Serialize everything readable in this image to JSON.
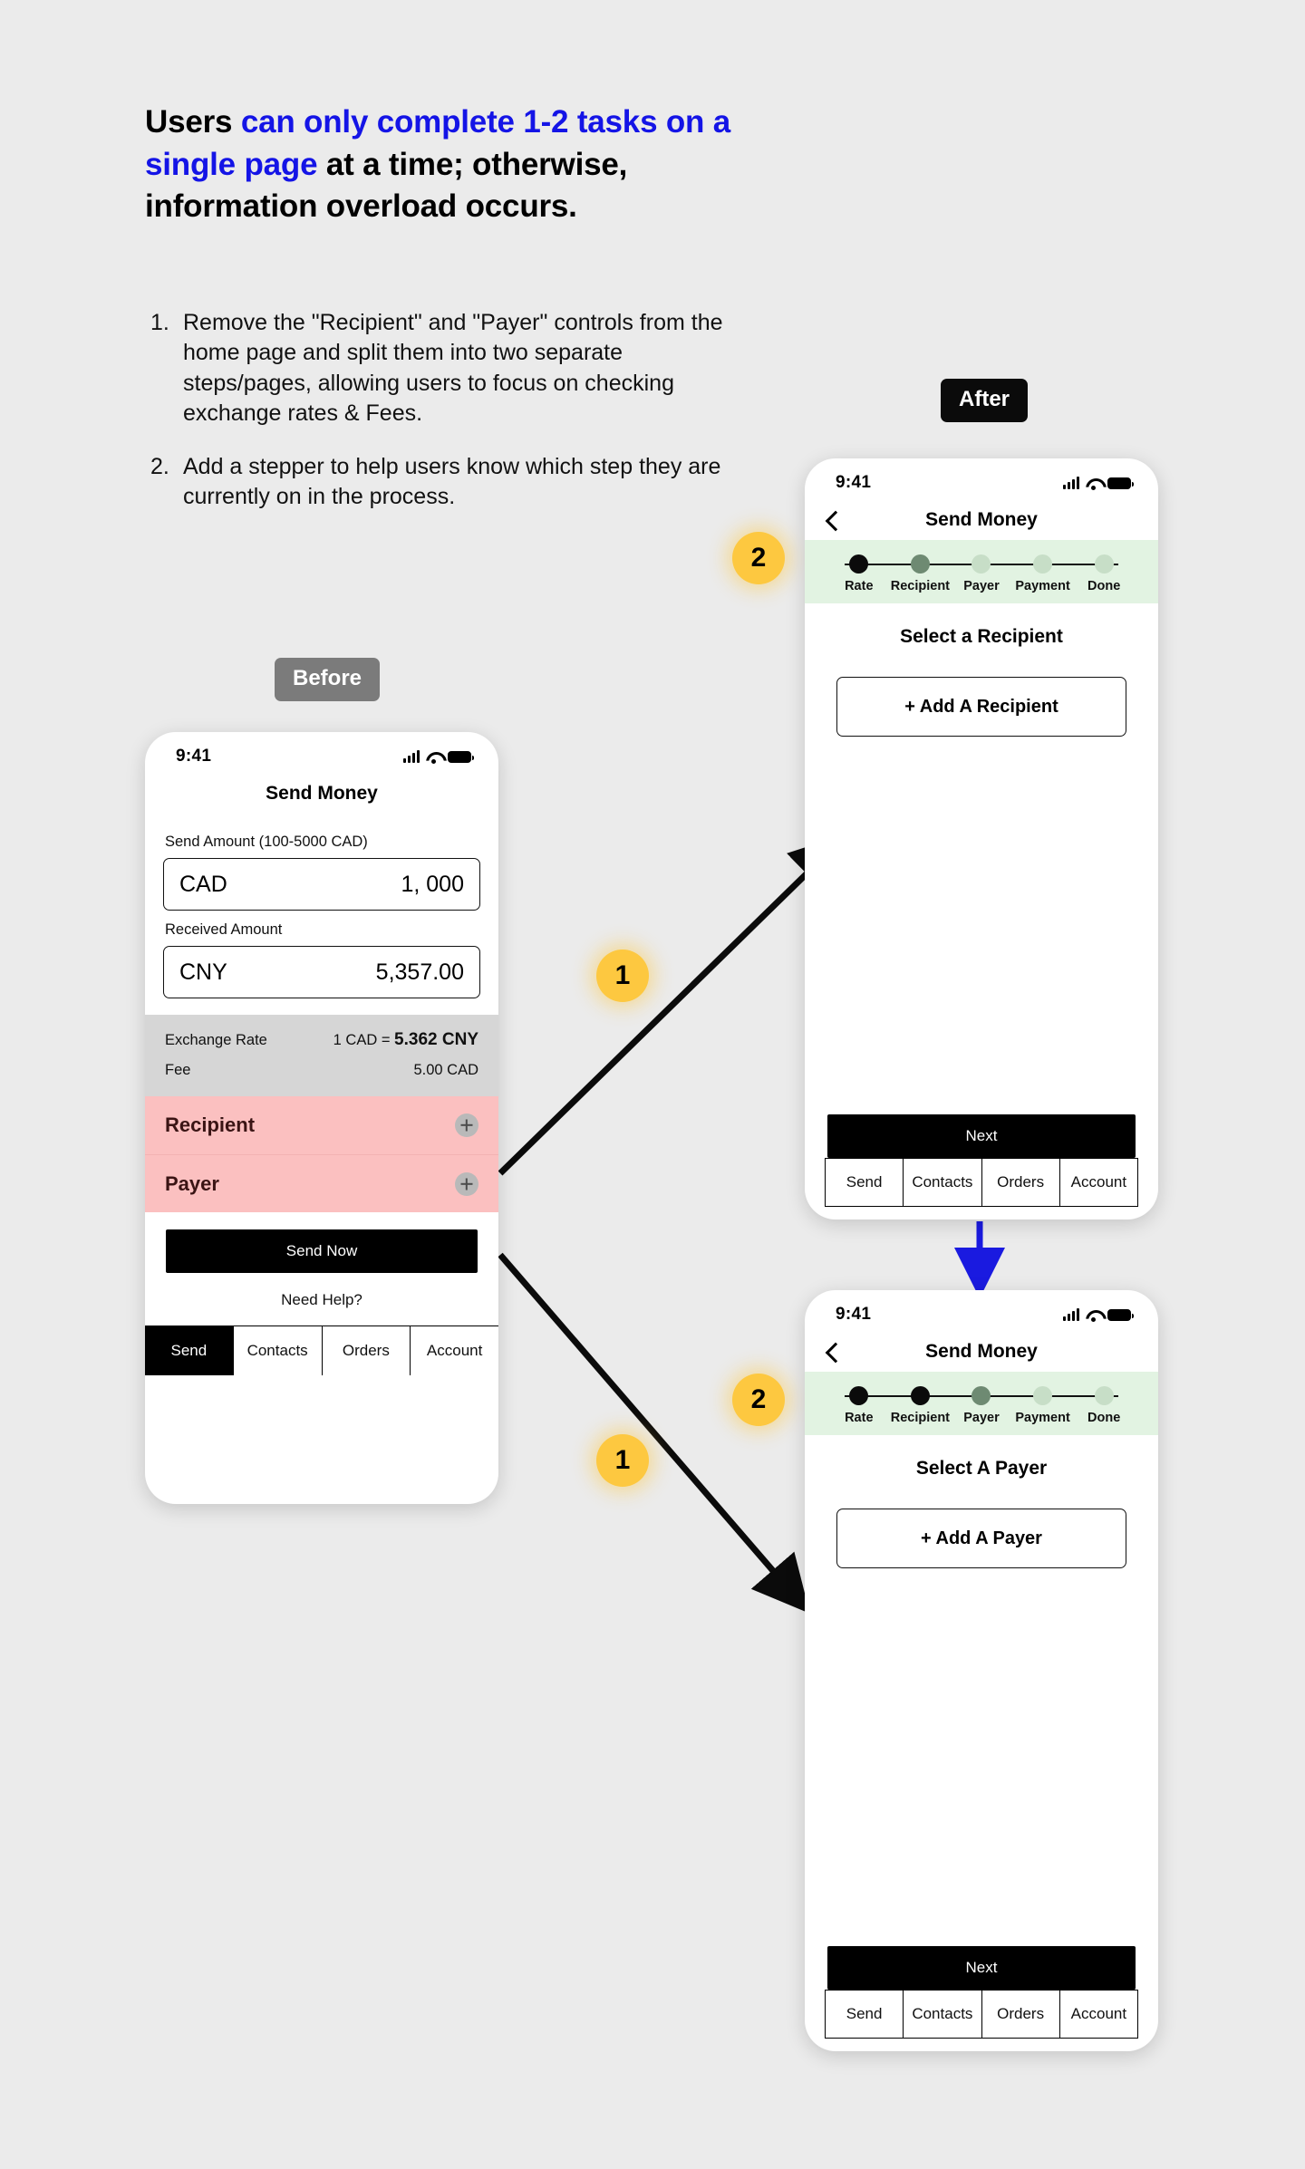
{
  "headline": {
    "lead": "Users ",
    "highlight": "can only complete 1-2 tasks on a single page",
    "tail": " at a time; otherwise, information overload occurs.",
    "highlight_color": "#1414e6"
  },
  "notes": [
    {
      "num": "1.",
      "text": "Remove the \"Recipient\" and \"Payer\" controls from the home page and split them into two separate steps/pages, allowing users to focus on checking exchange rates & Fees."
    },
    {
      "num": "2.",
      "text": "Add a stepper to help users know which step they are currently on in the process."
    }
  ],
  "pills": {
    "before": "Before",
    "after": "After"
  },
  "badges": {
    "one_a": "1",
    "one_b": "1",
    "two_a": "2",
    "two_b": "2",
    "color": "#fdc840"
  },
  "before_phone": {
    "status": {
      "time": "9:41",
      "signal": "signal-icon",
      "wifi": "wifi-icon",
      "battery": "battery-icon"
    },
    "header_title": "Send Money",
    "send_amount_label": "Send Amount (100-5000 CAD)",
    "send_currency": "CAD",
    "send_value": "1, 000",
    "received_label": "Received Amount",
    "received_currency": "CNY",
    "received_value": "5,357.00",
    "rate_label": "Exchange Rate",
    "rate_prefix": "1 CAD = ",
    "rate_value": "5.362 CNY",
    "fee_label": "Fee",
    "fee_value": "5.00 CAD",
    "recipient_row": "Recipient",
    "payer_row": "Payer",
    "row_plus_icon": "plus-circle-icon",
    "primary_button": "Send Now",
    "help_link": "Need Help?",
    "tabs": [
      {
        "label": "Send",
        "active": true
      },
      {
        "label": "Contacts",
        "active": false
      },
      {
        "label": "Orders",
        "active": false
      },
      {
        "label": "Account",
        "active": false
      }
    ]
  },
  "after_phone_1": {
    "status": {
      "time": "9:41"
    },
    "back_icon": "back-chevron-icon",
    "header_title": "Send Money",
    "stepper": [
      {
        "label": "Rate",
        "state": "done"
      },
      {
        "label": "Recipient",
        "state": "current"
      },
      {
        "label": "Payer",
        "state": "upcoming"
      },
      {
        "label": "Payment",
        "state": "upcoming"
      },
      {
        "label": "Done",
        "state": "upcoming"
      }
    ],
    "section_title": "Select a Recipient",
    "add_button": "+ Add A Recipient",
    "next_button": "Next",
    "tabs": [
      {
        "label": "Send",
        "active": false
      },
      {
        "label": "Contacts",
        "active": false
      },
      {
        "label": "Orders",
        "active": false
      },
      {
        "label": "Account",
        "active": false
      }
    ]
  },
  "after_phone_2": {
    "status": {
      "time": "9:41"
    },
    "back_icon": "back-chevron-icon",
    "header_title": "Send Money",
    "stepper": [
      {
        "label": "Rate",
        "state": "done"
      },
      {
        "label": "Recipient",
        "state": "done"
      },
      {
        "label": "Payer",
        "state": "current"
      },
      {
        "label": "Payment",
        "state": "upcoming"
      },
      {
        "label": "Done",
        "state": "upcoming"
      }
    ],
    "section_title": "Select A Payer",
    "add_button": "+ Add A Payer",
    "next_button": "Next",
    "tabs": [
      {
        "label": "Send",
        "active": false
      },
      {
        "label": "Contacts",
        "active": false
      },
      {
        "label": "Orders",
        "active": false
      },
      {
        "label": "Account",
        "active": false
      }
    ]
  },
  "colors": {
    "background": "#ebebeb",
    "pink_row": "#fbc0c0",
    "stepper_bg": "#e2f3e2",
    "rate_block": "#d6d6d6",
    "flow_arrow": "#0b0b0b",
    "blue_arrow": "#1a1ae0"
  }
}
